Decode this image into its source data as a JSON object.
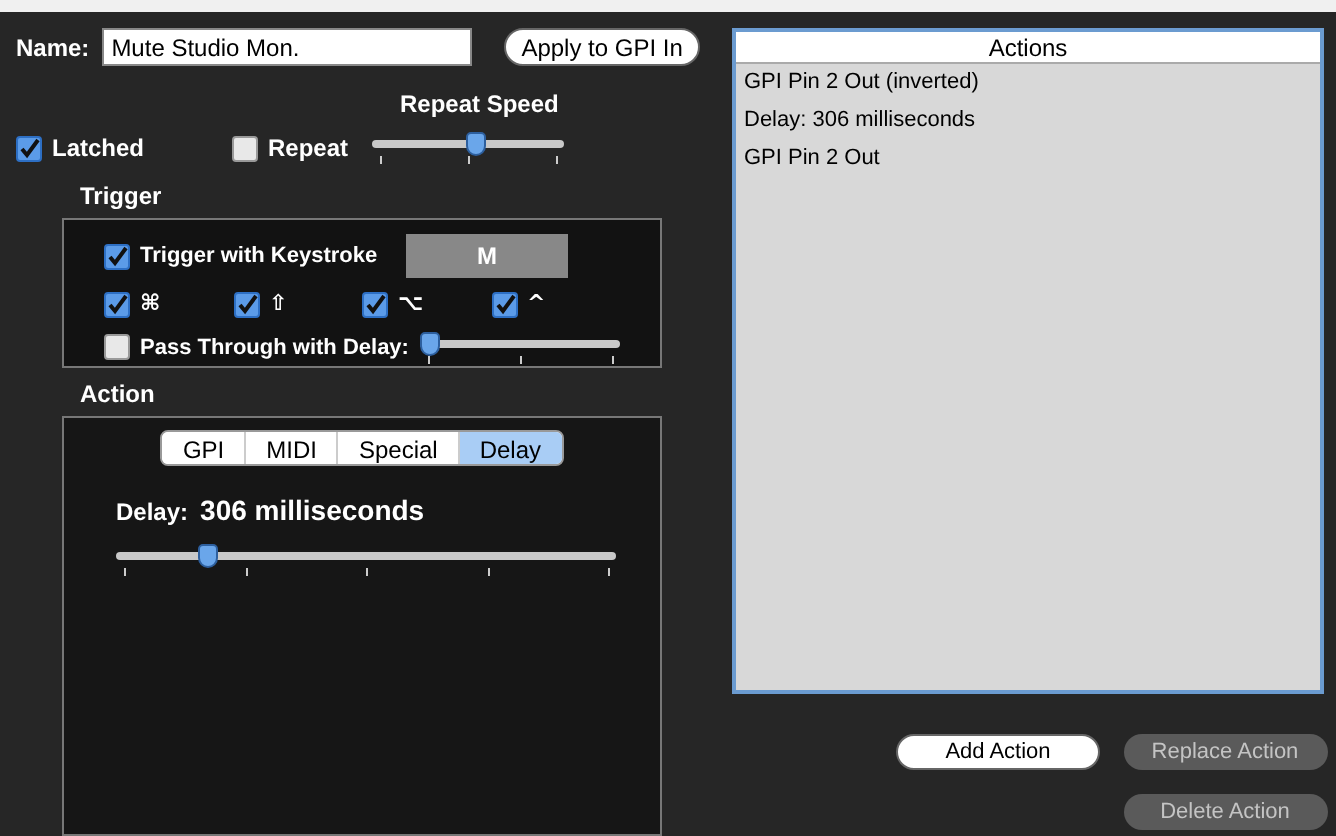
{
  "name_field": {
    "label": "Name:",
    "value": "Mute Studio Mon."
  },
  "apply_button": {
    "label": "Apply to GPI In"
  },
  "repeat_speed": {
    "label": "Repeat Speed",
    "level": 0.55
  },
  "latched": {
    "label": "Latched",
    "checked": true
  },
  "repeat": {
    "label": "Repeat",
    "checked": false
  },
  "trigger": {
    "title": "Trigger",
    "keystroke": {
      "label": "Trigger with Keystroke",
      "checked": true,
      "key": "M"
    },
    "modifiers": [
      {
        "symbol": "⌘",
        "checked": true
      },
      {
        "symbol": "⇧",
        "checked": true
      },
      {
        "symbol": "⌥",
        "checked": true
      },
      {
        "symbol": "^",
        "checked": true
      }
    ],
    "pass_through": {
      "label": "Pass Through with Delay:",
      "checked": false,
      "level": 0.0
    }
  },
  "action": {
    "title": "Action",
    "tabs": [
      {
        "label": "GPI",
        "selected": false
      },
      {
        "label": "MIDI",
        "selected": false
      },
      {
        "label": "Special",
        "selected": false
      },
      {
        "label": "Delay",
        "selected": true
      }
    ],
    "delay_label": "Delay:",
    "delay_value": "306 milliseconds",
    "level": 0.17
  },
  "actions_list": {
    "header": "Actions",
    "items": [
      {
        "text": "GPI Pin 2 Out (inverted)"
      },
      {
        "text": "Delay: 306 milliseconds"
      },
      {
        "text": "GPI Pin 2 Out"
      }
    ]
  },
  "buttons": [
    {
      "label": "Add Action",
      "disabled": false
    },
    {
      "label": "Replace Action",
      "disabled": true
    },
    {
      "label": "Delete Action",
      "disabled": true
    }
  ]
}
